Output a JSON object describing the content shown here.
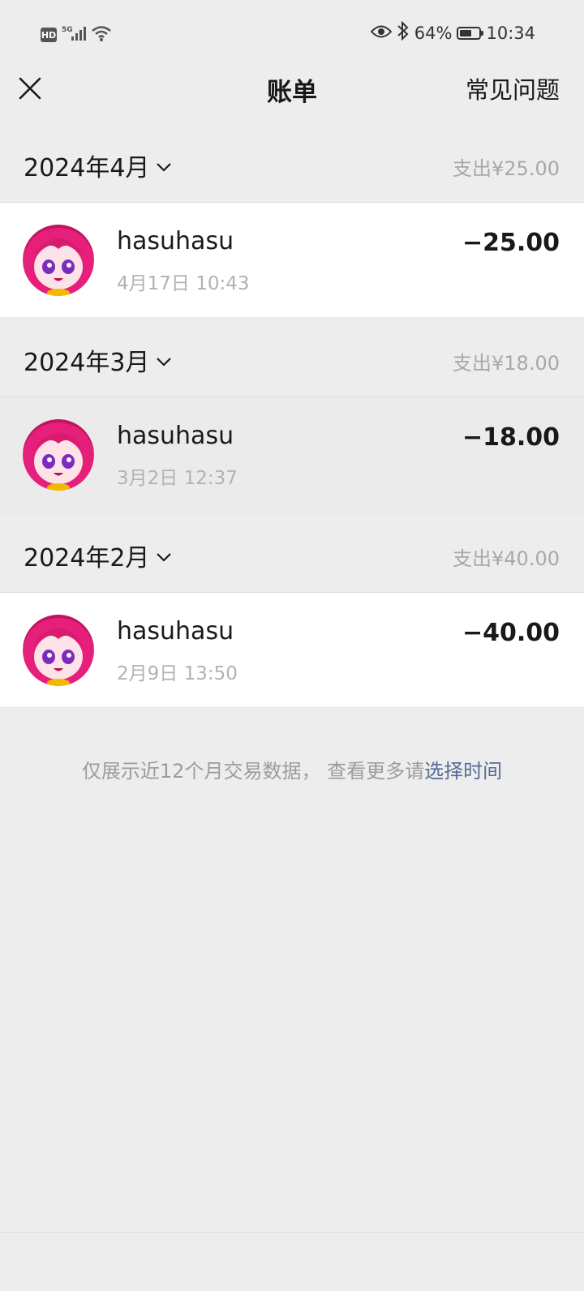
{
  "status_bar": {
    "hd": "HD",
    "network": "5G",
    "battery_percent": "64%",
    "battery_level": 0.64,
    "time": "10:34"
  },
  "nav": {
    "title": "账单",
    "faq": "常见问题"
  },
  "months": [
    {
      "label": "2024年4月",
      "total": "支出¥25.00",
      "transactions": [
        {
          "name": "hasuhasu",
          "time": "4月17日 10:43",
          "amount": "−25.00"
        }
      ]
    },
    {
      "label": "2024年3月",
      "total": "支出¥18.00",
      "transactions": [
        {
          "name": "hasuhasu",
          "time": "3月2日 12:37",
          "amount": "−18.00"
        }
      ]
    },
    {
      "label": "2024年2月",
      "total": "支出¥40.00",
      "transactions": [
        {
          "name": "hasuhasu",
          "time": "2月9日 13:50",
          "amount": "−40.00"
        }
      ]
    }
  ],
  "footer": {
    "note": "仅展示近12个月交易数据， 查看更多请",
    "link": "选择时间"
  },
  "colors": {
    "background": "#ededed",
    "link": "#576b95",
    "avatar_primary": "#e6207a"
  }
}
